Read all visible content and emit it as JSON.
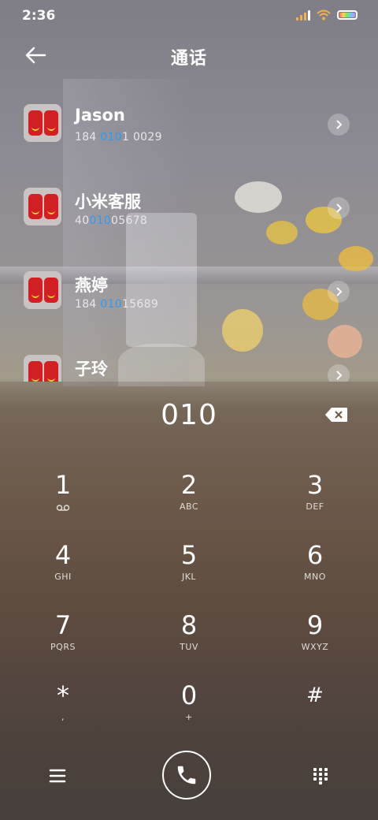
{
  "status_bar": {
    "time": "2:36"
  },
  "header": {
    "title": "通话"
  },
  "contacts": [
    {
      "name": "Jason",
      "number_parts": [
        "184 ",
        "010",
        "1 0029"
      ]
    },
    {
      "name": "小米客服",
      "number_parts": [
        "40",
        "010",
        "05678"
      ]
    },
    {
      "name": "燕婷",
      "number_parts": [
        "184 ",
        "010",
        "15689"
      ]
    },
    {
      "name": "子玲",
      "number_parts": [
        "",
        "",
        ""
      ]
    }
  ],
  "dialer": {
    "entered": "010",
    "keys": [
      {
        "num": "1",
        "sub": "voicemail"
      },
      {
        "num": "2",
        "sub": "ABC"
      },
      {
        "num": "3",
        "sub": "DEF"
      },
      {
        "num": "4",
        "sub": "GHI"
      },
      {
        "num": "5",
        "sub": "JKL"
      },
      {
        "num": "6",
        "sub": "MNO"
      },
      {
        "num": "7",
        "sub": "PQRS"
      },
      {
        "num": "8",
        "sub": "TUV"
      },
      {
        "num": "9",
        "sub": "WXYZ"
      },
      {
        "num": "*",
        "sub": ","
      },
      {
        "num": "0",
        "sub": "+"
      },
      {
        "num": "#",
        "sub": ""
      }
    ]
  },
  "colors": {
    "highlight": "#2f9bf2",
    "accent_avatar": "#d21f24"
  },
  "icons": [
    "back-arrow-icon",
    "chevron-right-icon",
    "backspace-icon",
    "voicemail-icon",
    "menu-icon",
    "phone-icon",
    "keypad-icon",
    "signal-icon",
    "wifi-icon",
    "battery-icon"
  ]
}
